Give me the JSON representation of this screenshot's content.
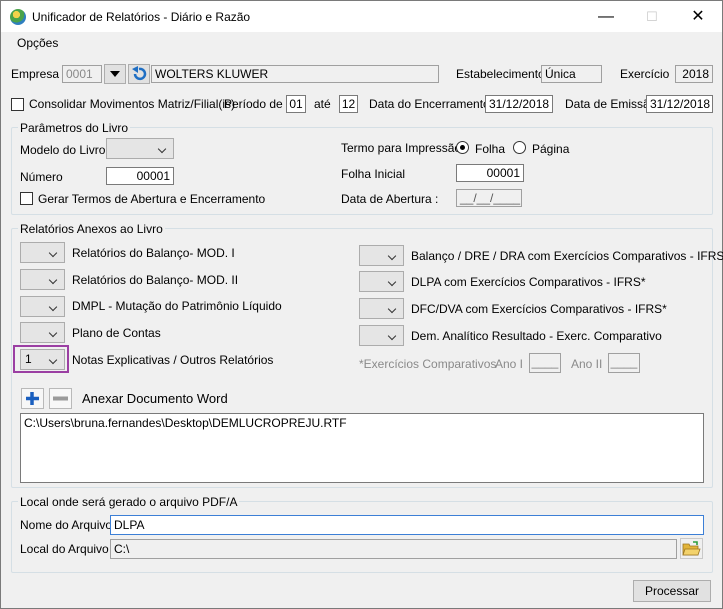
{
  "window": {
    "title": "Unificador de Relatórios - Diário e Razão",
    "minimize": "—",
    "maximize": "☐",
    "close": "✕"
  },
  "menu": {
    "options": "Opções"
  },
  "top": {
    "empresa_label": "Empresa",
    "empresa_code": "0001",
    "empresa_name": "WOLTERS KLUWER",
    "estabelecimento_label": "Estabelecimento",
    "estabelecimento_value": "Única",
    "exercicio_label": "Exercício",
    "exercicio_value": "2018",
    "consolidar_label": "Consolidar Movimentos Matriz/Filial(is)",
    "periodo_label": "Período de",
    "periodo_de": "01",
    "ate_label": "até",
    "periodo_ate": "12",
    "data_encerramento_label": "Data do Encerramento",
    "data_encerramento_value": "31/12/2018",
    "data_emissao_label": "Data de Emissão",
    "data_emissao_value": "31/12/2018"
  },
  "params": {
    "title": "Parâmetros do Livro",
    "modelo_label": "Modelo do Livro",
    "modelo_value": "",
    "numero_label": "Número",
    "numero_value": "00001",
    "gerar_termos_label": "Gerar Termos de Abertura e Encerramento",
    "termo_label": "Termo para Impressão",
    "folha_label": "Folha",
    "pagina_label": "Página",
    "folha_inicial_label": "Folha Inicial",
    "folha_inicial_value": "00001",
    "data_abertura_label": "Data de Abertura :",
    "data_abertura_value": "__/__/____"
  },
  "anexos": {
    "title": "Relatórios Anexos ao Livro",
    "left_items": [
      {
        "value": "",
        "label": "Relatórios do Balanço- MOD. I"
      },
      {
        "value": "",
        "label": "Relatórios do Balanço- MOD. II"
      },
      {
        "value": "",
        "label": "DMPL - Mutação do Patrimônio Líquido"
      },
      {
        "value": "",
        "label": "Plano de Contas"
      },
      {
        "value": "1",
        "label": "Notas Explicativas / Outros Relatórios"
      }
    ],
    "right_items": [
      {
        "value": "",
        "label": "Balanço / DRE / DRA com Exercícios Comparativos - IFRS*"
      },
      {
        "value": "",
        "label": "DLPA com Exercícios Comparativos - IFRS*"
      },
      {
        "value": "",
        "label": "DFC/DVA com Exercícios Comparativos - IFRS*"
      },
      {
        "value": "",
        "label": "Dem. Analítico Resultado - Exerc. Comparativo"
      }
    ],
    "exercicios_label": "*Exercícios Comparativos",
    "ano1_label": "Ano I",
    "ano1_value": "____",
    "ano2_label": "Ano II",
    "ano2_value": "____",
    "anexar_label": "Anexar Documento Word",
    "files": [
      "C:\\Users\\bruna.fernandes\\Desktop\\DEMLUCROPREJU.RTF"
    ]
  },
  "local": {
    "title": "Local onde será gerado o arquivo PDF/A",
    "nome_label": "Nome do Arquivo",
    "nome_value": "DLPA",
    "local_label": "Local do Arquivo",
    "local_value": "C:\\"
  },
  "actions": {
    "processar": "Processar"
  }
}
